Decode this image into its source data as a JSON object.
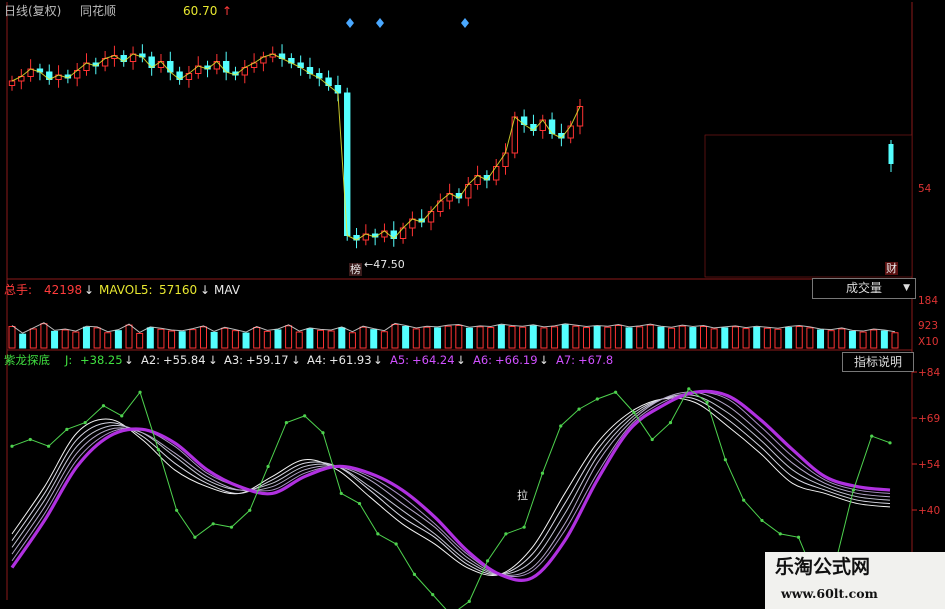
{
  "header": {
    "period": "日线(复权)",
    "stock_name": "同花顺",
    "price": "60.70",
    "price_arrow": "↑"
  },
  "volume_header": {
    "total_label": "总手:",
    "total_value": "42198",
    "total_arrow": "↓",
    "mavol5_label": "MAVOL5:",
    "mavol5_value": "57160",
    "mavol5_arrow": "↓",
    "mavol10_label": "MAV"
  },
  "indicator_header": {
    "name": "紫龙探底",
    "j_label": "J:",
    "j_value": "+38.25",
    "a2_label": "A2:",
    "a2_value": "+55.84",
    "a3_label": "A3:",
    "a3_value": "+59.17",
    "a4_label": "A4:",
    "a4_value": "+61.93",
    "a5_label": "A5:",
    "a5_value": "+64.24",
    "a6_label": "A6:",
    "a6_value": "+66.19",
    "a7_label": "A7:",
    "a7_value": "+67.8",
    "arrow": "↓"
  },
  "buttons": {
    "volume_select": "成交量",
    "volume_select_caret": "▼",
    "indicator_help": "指标说明"
  },
  "annotations": {
    "low_marker": "榜",
    "low_price": "←47.50",
    "bottom_mark": "拉",
    "right_mark": "财"
  },
  "right_axis": {
    "price_tick": "54",
    "volume_tick_1": "184",
    "volume_tick_2": "923",
    "volume_unit": "X10",
    "ind_tick_1": "+84",
    "ind_tick_2": "+69",
    "ind_tick_3": "+54",
    "ind_tick_4": "+40"
  },
  "watermark": {
    "title": "乐淘公式网",
    "url": "www.60lt.com"
  },
  "colors": {
    "background": "#000000",
    "up_candle": "#ff3333",
    "down_candle": "#54ffff",
    "j_line": "#4ed24e",
    "a7_line": "#b030e0",
    "ma_line": "#e8e8e8",
    "axis": "#cc2222"
  },
  "chart_data": [
    {
      "type": "candlestick",
      "name": "price",
      "low_label": 47.5,
      "current": 60.7,
      "closes": [
        58.6,
        58.9,
        59.4,
        59.2,
        58.7,
        59.0,
        58.8,
        59.3,
        59.8,
        59.6,
        60.1,
        60.3,
        59.9,
        60.4,
        60.2,
        59.5,
        59.9,
        59.2,
        58.7,
        59.1,
        59.6,
        59.4,
        59.9,
        59.2,
        59.0,
        59.5,
        59.8,
        60.2,
        60.4,
        60.1,
        59.8,
        59.5,
        59.1,
        58.8,
        58.3,
        57.8,
        48.3,
        48.0,
        48.4,
        48.2,
        48.6,
        48.1,
        48.8,
        49.4,
        49.2,
        49.9,
        50.6,
        51.1,
        50.8,
        51.7,
        52.3,
        52.0,
        52.9,
        53.8,
        56.2,
        55.7,
        55.3,
        56.0,
        55.1,
        54.8,
        55.6,
        56.9
      ]
    },
    {
      "type": "bar",
      "name": "volume",
      "values": [
        62,
        40,
        55,
        70,
        48,
        52,
        46,
        60,
        58,
        44,
        50,
        66,
        42,
        58,
        54,
        49,
        47,
        53,
        61,
        45,
        57,
        50,
        43,
        59,
        48,
        52,
        64,
        46,
        55,
        51,
        49,
        58,
        44,
        60,
        53,
        47,
        68,
        62,
        55,
        60,
        58,
        63,
        65,
        57,
        61,
        59,
        66,
        62,
        60,
        64,
        58,
        61,
        67,
        63,
        59,
        62,
        60,
        65,
        58,
        61,
        66,
        60,
        57,
        63,
        59,
        62,
        55,
        58,
        61,
        56,
        60,
        57,
        54,
        59,
        62,
        58,
        52,
        50,
        55,
        48,
        46,
        52,
        49,
        44
      ]
    },
    {
      "type": "line",
      "name": "紫龙探底",
      "series": [
        {
          "name": "J",
          "values": [
            70,
            72,
            70,
            75,
            77,
            82,
            79,
            86,
            69,
            51,
            43,
            47,
            46,
            51,
            64,
            77,
            79,
            74,
            56,
            53,
            44,
            41,
            32,
            26,
            20,
            24,
            36,
            44,
            46,
            62,
            76,
            81,
            84,
            86,
            80,
            72,
            77,
            87,
            83,
            66,
            54,
            48,
            44,
            43,
            30,
            35,
            57,
            73,
            71
          ]
        },
        {
          "name": "A2",
          "values": [
            44,
            58,
            74,
            78,
            72,
            63,
            58,
            56,
            61,
            66,
            63,
            55,
            47,
            41,
            34,
            32,
            40,
            56,
            71,
            80,
            84,
            83,
            76,
            68,
            59,
            56,
            53,
            52
          ]
        },
        {
          "name": "A3",
          "values": [
            42,
            56,
            72,
            77,
            73,
            65,
            59,
            56,
            60,
            65,
            64,
            57,
            49,
            43,
            35,
            32,
            38,
            53,
            69,
            79,
            84,
            84,
            78,
            70,
            61,
            57,
            54,
            53
          ]
        },
        {
          "name": "A4",
          "values": [
            40,
            54,
            70,
            76,
            74,
            67,
            60,
            57,
            59,
            64,
            64,
            58,
            51,
            44,
            36,
            32,
            36,
            50,
            67,
            78,
            84,
            85,
            80,
            72,
            63,
            58,
            55,
            54
          ]
        },
        {
          "name": "A5",
          "values": [
            38,
            52,
            68,
            75,
            74,
            68,
            61,
            57,
            58,
            63,
            64,
            60,
            53,
            46,
            37,
            32,
            34,
            47,
            65,
            77,
            84,
            86,
            82,
            74,
            65,
            59,
            56,
            55
          ]
        },
        {
          "name": "A6",
          "values": [
            36,
            50,
            66,
            74,
            75,
            70,
            62,
            58,
            57,
            62,
            64,
            61,
            55,
            47,
            38,
            32,
            33,
            45,
            62,
            76,
            83,
            86,
            84,
            76,
            67,
            60,
            57,
            56
          ]
        },
        {
          "name": "A7",
          "values": [
            34,
            48,
            64,
            73,
            75,
            71,
            63,
            58,
            56,
            61,
            64,
            62,
            57,
            49,
            39,
            32,
            31,
            42,
            60,
            75,
            82,
            86,
            85,
            78,
            69,
            61,
            58,
            57
          ]
        }
      ],
      "ylim": [
        25,
        92
      ]
    }
  ]
}
